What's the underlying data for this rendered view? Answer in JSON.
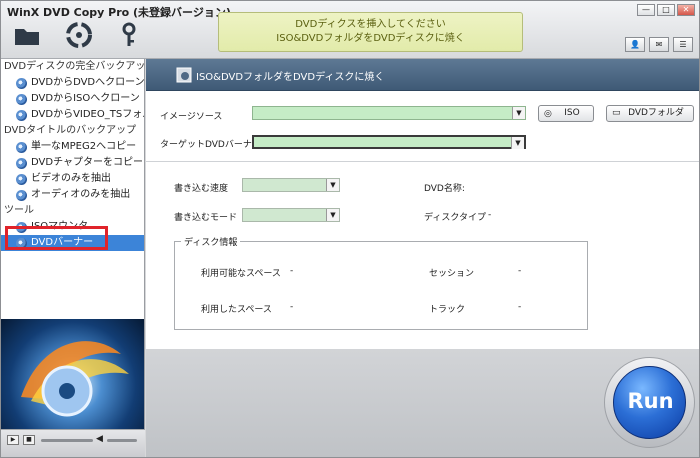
{
  "window": {
    "title": "WinX DVD Copy Pro (未登録バージョン)",
    "controls": [
      "—",
      "□",
      "✕"
    ]
  },
  "notice": {
    "line1": "DVDディクスを挿入してください",
    "line2": "ISO&DVDフォルダをDVDディスクに焼く"
  },
  "toolbar": {
    "icons": [
      "folder-icon",
      "disc-icon",
      "key-icon"
    ]
  },
  "utility_icons": [
    "user-icon",
    "mail-icon",
    "menu-icon"
  ],
  "sidebar": {
    "sections": [
      {
        "label": "DVDディスクの完全バックアップ",
        "items": [
          "DVDからDVDへクローン",
          "DVDからISOへクローン",
          "DVDからVIDEO_TSフォルダへ"
        ]
      },
      {
        "label": "DVDタイトルのバックアップ",
        "items": [
          "単一なMPEG2へコピー",
          "DVDチャプターをコピー",
          "ビデオのみを抽出",
          "オーディオのみを抽出"
        ]
      },
      {
        "label": "ツール",
        "items": [
          "ISOマウンタ",
          "DVDバーナー"
        ]
      }
    ],
    "selected": "DVDバーナー"
  },
  "main": {
    "header_title": "ISO&DVDフォルダをDVDディスクに焼く",
    "image_source_label": "イメージソース",
    "image_source_value": "",
    "iso_button": "ISO",
    "dvd_folder_button": "DVDフォルダ",
    "target_label": "ターゲットDVDバーナー",
    "target_value": "",
    "write_speed_label": "書き込む速度",
    "write_mode_label": "書き込むモード",
    "dvd_name_label": "DVD名称:",
    "disc_type_label": "ディスクタイプ",
    "disc_type_value": "-",
    "disc_info": {
      "legend": "ディスク情報",
      "available_label": "利用可能なスペース",
      "available_value": "-",
      "used_label": "利用したスペース",
      "used_value": "-",
      "session_label": "セッション",
      "session_value": "-",
      "track_label": "トラック",
      "track_value": "-"
    }
  },
  "run": {
    "label": "Run"
  },
  "colors": {
    "field_green": "#c5ecc6",
    "header_blue": "#4f6985",
    "selection_blue": "#3c84d8",
    "highlight_red": "#e0232a"
  }
}
